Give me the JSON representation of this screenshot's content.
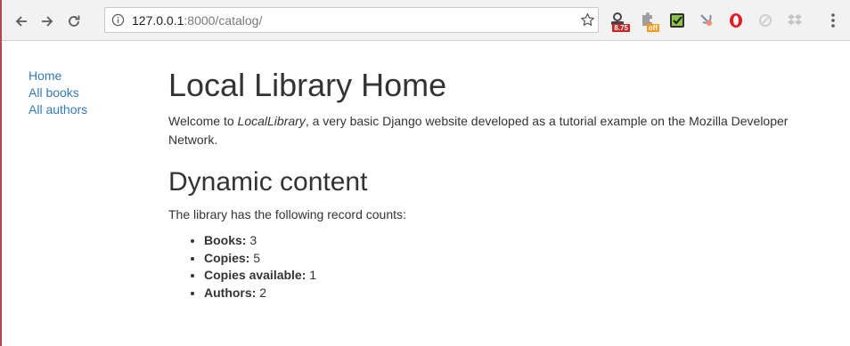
{
  "browser": {
    "url_host": "127.0.0.1",
    "url_path": ":8000/catalog/",
    "extensions": [
      {
        "name": "timer-extension",
        "badge": "8.75",
        "badge_color": "#c62828"
      },
      {
        "name": "off-extension",
        "badge": "off",
        "badge_color": "#f29b1d"
      },
      {
        "name": "check-extension"
      },
      {
        "name": "satellite-extension"
      },
      {
        "name": "opera-extension"
      },
      {
        "name": "disabled-extension"
      },
      {
        "name": "dropbox-extension"
      }
    ]
  },
  "sidebar": {
    "items": [
      {
        "label": "Home"
      },
      {
        "label": "All books"
      },
      {
        "label": "All authors"
      }
    ]
  },
  "main": {
    "title": "Local Library Home",
    "welcome_prefix": "Welcome to ",
    "welcome_em": "LocalLibrary",
    "welcome_suffix": ", a very basic Django website developed as a tutorial example on the Mozilla Developer Network.",
    "section_title": "Dynamic content",
    "lead": "The library has the following record counts:",
    "counts": [
      {
        "label": "Books:",
        "value": "3"
      },
      {
        "label": "Copies:",
        "value": "5"
      },
      {
        "label": "Copies available:",
        "value": "1"
      },
      {
        "label": "Authors:",
        "value": "2"
      }
    ]
  },
  "colors": {
    "link": "#337ab7",
    "text": "#333333",
    "window_border": "#b5454f"
  }
}
